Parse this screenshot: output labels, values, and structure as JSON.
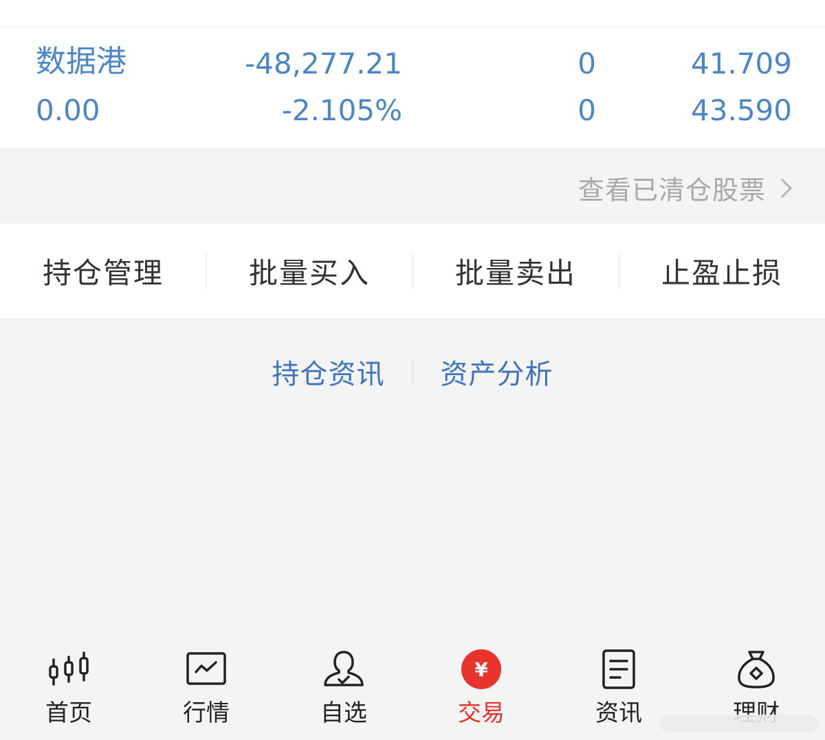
{
  "position": {
    "name": "数据港",
    "sub_value": "0.00",
    "pnl": "-48,277.21",
    "pnl_pct": "-2.105%",
    "qty_hold": "0",
    "qty_avail": "0",
    "price_current": "41.709",
    "price_cost": "43.590"
  },
  "cleared_stocks_link": "查看已清仓股票",
  "actions": [
    "持仓管理",
    "批量买入",
    "批量卖出",
    "止盈止损"
  ],
  "links": [
    "持仓资讯",
    "资产分析"
  ],
  "tabs": [
    {
      "label": "首页",
      "icon": "candlestick-icon"
    },
    {
      "label": "行情",
      "icon": "chart-line-icon"
    },
    {
      "label": "自选",
      "icon": "user-check-icon"
    },
    {
      "label": "交易",
      "icon": "yuan-circle-icon",
      "active": true
    },
    {
      "label": "资讯",
      "icon": "document-icon"
    },
    {
      "label": "理财",
      "icon": "money-bag-icon"
    }
  ],
  "colors": {
    "accent": "#4a86c8",
    "link": "#3f73bd",
    "active_tab": "#e8342c",
    "muted": "#a8a8a8"
  }
}
